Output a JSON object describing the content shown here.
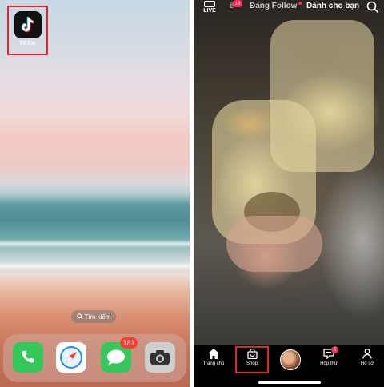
{
  "left_screen": {
    "app": {
      "label": "TikTok",
      "icon": "tiktok-icon"
    },
    "search_pill": {
      "label": "Tìm kiếm",
      "icon": "search-icon"
    },
    "dock": {
      "apps": [
        {
          "name": "Phone",
          "icon": "phone-icon",
          "color": "#34c759"
        },
        {
          "name": "Safari",
          "icon": "compass-icon",
          "color": "#ffffff"
        },
        {
          "name": "Messages",
          "icon": "message-bubble-icon",
          "color": "#34c759",
          "badge": "181"
        },
        {
          "name": "Camera",
          "icon": "camera-icon",
          "color": "#cfcfcf"
        }
      ]
    },
    "highlight_color": "#e0262d"
  },
  "right_screen": {
    "top_nav": {
      "live_label": "LIVE",
      "badge": "14",
      "fragment": "ề",
      "following": "Đang Follow",
      "for_you": "Dành cho bạn"
    },
    "bottom_nav": {
      "home": "Trang chủ",
      "shop": "Shop",
      "inbox": "Hộp thư",
      "inbox_badge": "5",
      "profile": "Hồ sơ"
    },
    "accent_color": "#fe2c55",
    "highlight_color": "#e0262d"
  }
}
